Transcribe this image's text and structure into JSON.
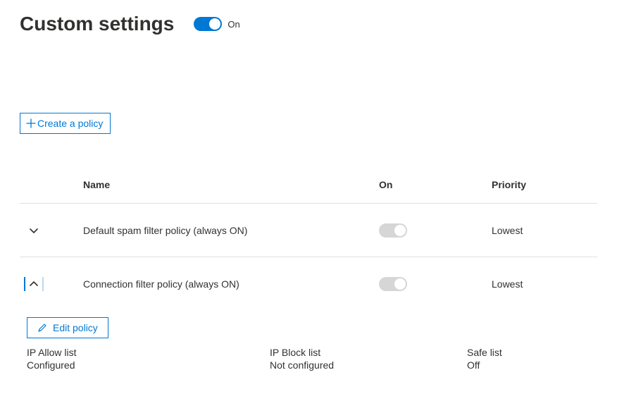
{
  "header": {
    "title": "Custom settings",
    "toggle_label": "On"
  },
  "actions": {
    "create_policy": "Create a policy",
    "edit_policy": "Edit policy"
  },
  "table": {
    "columns": {
      "name": "Name",
      "on": "On",
      "priority": "Priority"
    },
    "rows": [
      {
        "name": "Default spam filter policy (always ON)",
        "priority": "Lowest"
      },
      {
        "name": "Connection filter policy (always ON)",
        "priority": "Lowest"
      }
    ]
  },
  "details": {
    "ip_allow": {
      "label": "IP Allow list",
      "value": "Configured"
    },
    "ip_block": {
      "label": "IP Block list",
      "value": "Not configured"
    },
    "safe_list": {
      "label": "Safe list",
      "value": "Off"
    }
  }
}
